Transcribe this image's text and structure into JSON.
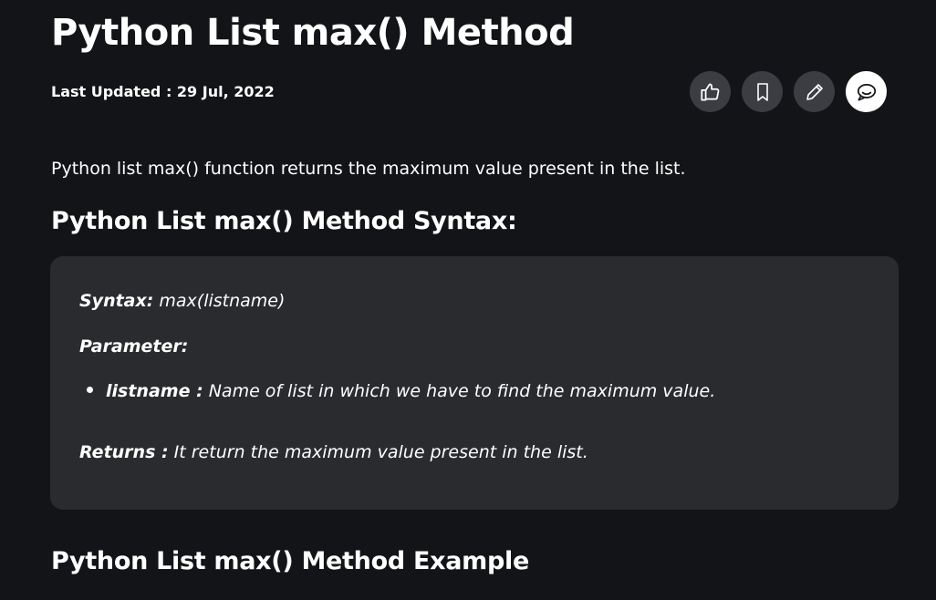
{
  "article": {
    "title": "Python List max() Method",
    "last_updated": "Last Updated : 29 Jul, 2022",
    "intro": "Python list max() function returns the maximum value present in the list.",
    "syntax_heading": "Python List max() Method Syntax:",
    "example_heading": "Python List max() Method Example"
  },
  "actions": [
    {
      "name": "like",
      "icon": "thumbs-up-icon"
    },
    {
      "name": "bookmark",
      "icon": "bookmark-icon"
    },
    {
      "name": "edit",
      "icon": "pencil-icon"
    },
    {
      "name": "comments",
      "icon": "comment-icon"
    }
  ],
  "syntax_box": {
    "syntax_label": "Syntax:",
    "syntax_value": " max(listname)",
    "parameter_label": "Parameter:",
    "param_name": "listname :",
    "param_desc": " Name of list in which we have to find the maximum value.",
    "returns_label": "Returns :",
    "returns_desc": " It return the maximum value present in the list."
  },
  "colors": {
    "background": "#131417",
    "box": "#2a2b2e",
    "action_button": "#3c3d42",
    "text": "#ffffff"
  }
}
